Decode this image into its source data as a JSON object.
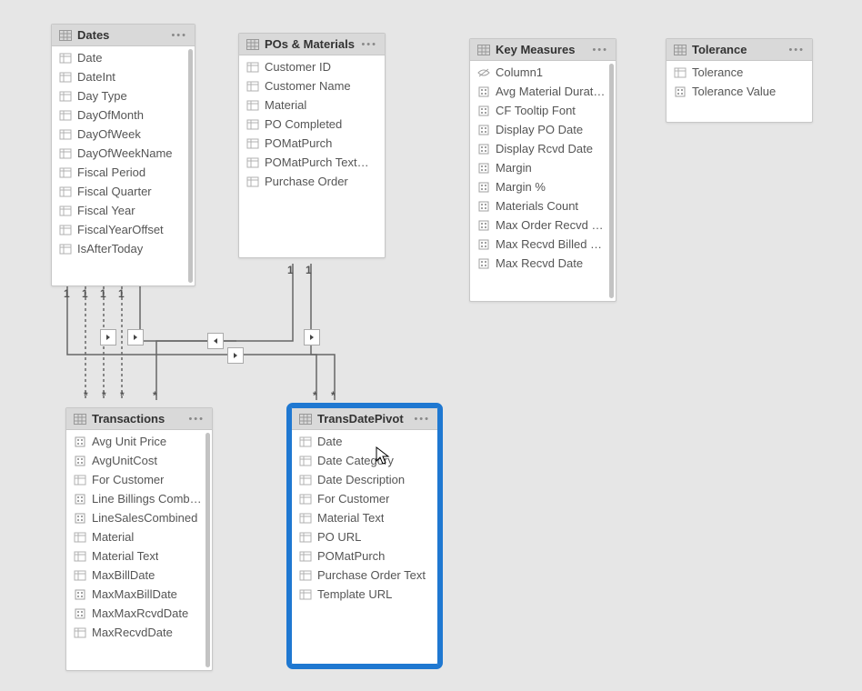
{
  "icons": {
    "table": "<svg viewBox='0 0 14 12'><rect x='0.5' y='0.5' width='13' height='11' fill='none' stroke='#999' stroke-width='1'/><line x1='0.5' y1='4' x2='13.5' y2='4' stroke='#999'/><line x1='0.5' y1='8' x2='13.5' y2='8' stroke='#999'/><line x1='5' y1='0.5' x2='5' y2='11.5' stroke='#999'/><line x1='9' y1='0.5' x2='9' y2='11.5' stroke='#999'/></svg>",
    "column": "<svg viewBox='0 0 14 12'><rect x='1' y='1' width='12' height='10' fill='none' stroke='#b0b0b0' stroke-width='1'/><line x1='1' y1='4' x2='13' y2='4' stroke='#b0b0b0'/><line x1='5' y1='1' x2='5' y2='11' stroke='#b0b0b0'/></svg>",
    "measure": "<svg viewBox='0 0 14 12'><rect x='2' y='1' width='10' height='10' fill='none' stroke='#a0a0a0' stroke-width='1'/><rect x='4' y='3' width='2' height='2' fill='#a0a0a0'/><rect x='8' y='3' width='2' height='2' fill='#a0a0a0'/><rect x='4' y='7' width='2' height='2' fill='#a0a0a0'/><rect x='8' y='7' width='2' height='2' fill='#a0a0a0'/></svg>",
    "hidden": "<svg viewBox='0 0 14 12'><path d='M1 6 Q7 0 13 6 Q7 12 1 6 Z' fill='none' stroke='#a0a0a0' stroke-width='1'/><line x1='2' y1='10' x2='12' y2='2' stroke='#a0a0a0' stroke-width='1'/></svg>"
  },
  "tables": [
    {
      "id": "card-dates",
      "title": "Dates",
      "scroll": true,
      "fields": [
        {
          "icon": "column",
          "label": "Date"
        },
        {
          "icon": "column",
          "label": "DateInt"
        },
        {
          "icon": "column",
          "label": "Day Type"
        },
        {
          "icon": "column",
          "label": "DayOfMonth"
        },
        {
          "icon": "column",
          "label": "DayOfWeek"
        },
        {
          "icon": "column",
          "label": "DayOfWeekName"
        },
        {
          "icon": "column",
          "label": "Fiscal Period"
        },
        {
          "icon": "column",
          "label": "Fiscal Quarter"
        },
        {
          "icon": "column",
          "label": "Fiscal Year"
        },
        {
          "icon": "column",
          "label": "FiscalYearOffset"
        },
        {
          "icon": "column",
          "label": "IsAfterToday"
        }
      ]
    },
    {
      "id": "card-pos",
      "title": "POs & Materials",
      "scroll": false,
      "fields": [
        {
          "icon": "column",
          "label": "Customer ID"
        },
        {
          "icon": "column",
          "label": "Customer Name"
        },
        {
          "icon": "column",
          "label": "Material"
        },
        {
          "icon": "column",
          "label": "PO Completed"
        },
        {
          "icon": "column",
          "label": "POMatPurch"
        },
        {
          "icon": "column",
          "label": "POMatPurch TextDisp"
        },
        {
          "icon": "column",
          "label": "Purchase Order"
        }
      ]
    },
    {
      "id": "card-key",
      "title": "Key Measures",
      "scroll": true,
      "fields": [
        {
          "icon": "hidden",
          "label": "Column1"
        },
        {
          "icon": "measure",
          "label": "Avg Material Duration..."
        },
        {
          "icon": "measure",
          "label": "CF Tooltip Font"
        },
        {
          "icon": "measure",
          "label": "Display PO Date"
        },
        {
          "icon": "measure",
          "label": "Display Rcvd Date"
        },
        {
          "icon": "measure",
          "label": "Margin"
        },
        {
          "icon": "measure",
          "label": "Margin %"
        },
        {
          "icon": "measure",
          "label": "Materials Count"
        },
        {
          "icon": "measure",
          "label": "Max Order Recvd Days"
        },
        {
          "icon": "measure",
          "label": "Max Recvd Billed Days"
        },
        {
          "icon": "measure",
          "label": "Max Recvd Date"
        }
      ]
    },
    {
      "id": "card-tol",
      "title": "Tolerance",
      "scroll": false,
      "fields": [
        {
          "icon": "column",
          "label": "Tolerance"
        },
        {
          "icon": "measure",
          "label": "Tolerance Value"
        }
      ]
    },
    {
      "id": "card-trans",
      "title": "Transactions",
      "scroll": true,
      "fields": [
        {
          "icon": "measure",
          "label": "Avg Unit Price"
        },
        {
          "icon": "measure",
          "label": "AvgUnitCost"
        },
        {
          "icon": "column",
          "label": "For Customer"
        },
        {
          "icon": "measure",
          "label": "Line Billings Combined"
        },
        {
          "icon": "measure",
          "label": "LineSalesCombined"
        },
        {
          "icon": "column",
          "label": "Material"
        },
        {
          "icon": "column",
          "label": "Material Text"
        },
        {
          "icon": "column",
          "label": "MaxBillDate"
        },
        {
          "icon": "measure",
          "label": "MaxMaxBillDate"
        },
        {
          "icon": "measure",
          "label": "MaxMaxRcvdDate"
        },
        {
          "icon": "column",
          "label": "MaxRecvdDate"
        }
      ]
    },
    {
      "id": "card-pivot",
      "title": "TransDatePivot",
      "scroll": false,
      "fields": [
        {
          "icon": "column",
          "label": "Date"
        },
        {
          "icon": "column",
          "label": "Date Category"
        },
        {
          "icon": "column",
          "label": "Date Description"
        },
        {
          "icon": "column",
          "label": "For Customer"
        },
        {
          "icon": "column",
          "label": "Material Text"
        },
        {
          "icon": "column",
          "label": "PO URL"
        },
        {
          "icon": "column",
          "label": "POMatPurch"
        },
        {
          "icon": "column",
          "label": "Purchase Order Text"
        },
        {
          "icon": "column",
          "label": "Template URL"
        }
      ]
    }
  ]
}
